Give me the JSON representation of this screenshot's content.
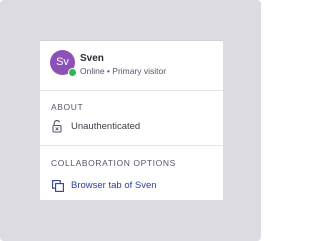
{
  "user": {
    "initials": "Sv",
    "name": "Sven",
    "status": "Online • Primary visitor",
    "avatar_color": "#8e4fb6",
    "presence_color": "#2fb84a"
  },
  "about": {
    "title": "ABOUT",
    "auth_icon": "unlocked-padlock-icon",
    "auth_text": "Unauthenticated"
  },
  "collaboration": {
    "title": "COLLABORATION OPTIONS",
    "link_icon": "browser-tab-icon",
    "link_text": "Browser tab of Sven",
    "link_color": "#2c3f9c"
  }
}
